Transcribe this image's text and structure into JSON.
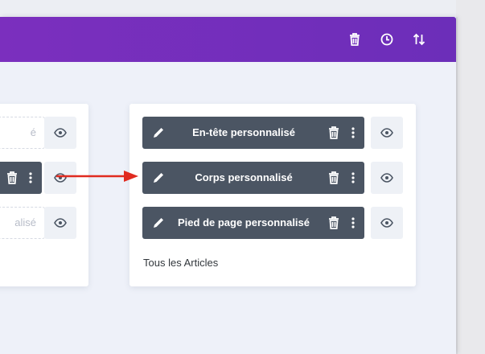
{
  "topbar": {
    "accent": "#7b2fbe",
    "icons": [
      "trash-icon",
      "history-icon",
      "sort-icon"
    ]
  },
  "left_card": {
    "slots": [
      {
        "state": "empty",
        "text": "é"
      },
      {
        "state": "filled",
        "text": ""
      },
      {
        "state": "empty",
        "text": "alisé"
      }
    ]
  },
  "right_card": {
    "slots": [
      {
        "label": "En-tête personnalisé"
      },
      {
        "label": "Corps personnalisé"
      },
      {
        "label": "Pied de page personnalisé"
      }
    ],
    "footer_text": "Tous les Articles"
  },
  "colors": {
    "slot_fill": "#4b5563",
    "eye_bg": "#eef1f6",
    "arrow": "#e02b20"
  }
}
